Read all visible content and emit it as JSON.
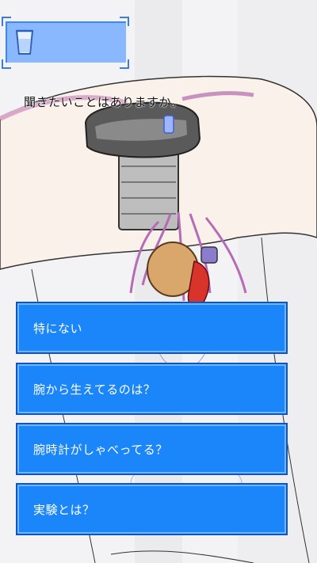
{
  "item_slot": {
    "icon": "cup-icon"
  },
  "dialogue": {
    "text": "聞きたいことはありますか。"
  },
  "choices": [
    {
      "label": "特にない"
    },
    {
      "label": "腕から生えてるのは？"
    },
    {
      "label": "腕時計がしゃべってる？"
    },
    {
      "label": "実験とは？"
    }
  ],
  "colors": {
    "choice_fill": "#1a86fa",
    "choice_border": "#0a55c8",
    "item_panel": "#8ab8ff",
    "skin": "#faf1ea"
  }
}
